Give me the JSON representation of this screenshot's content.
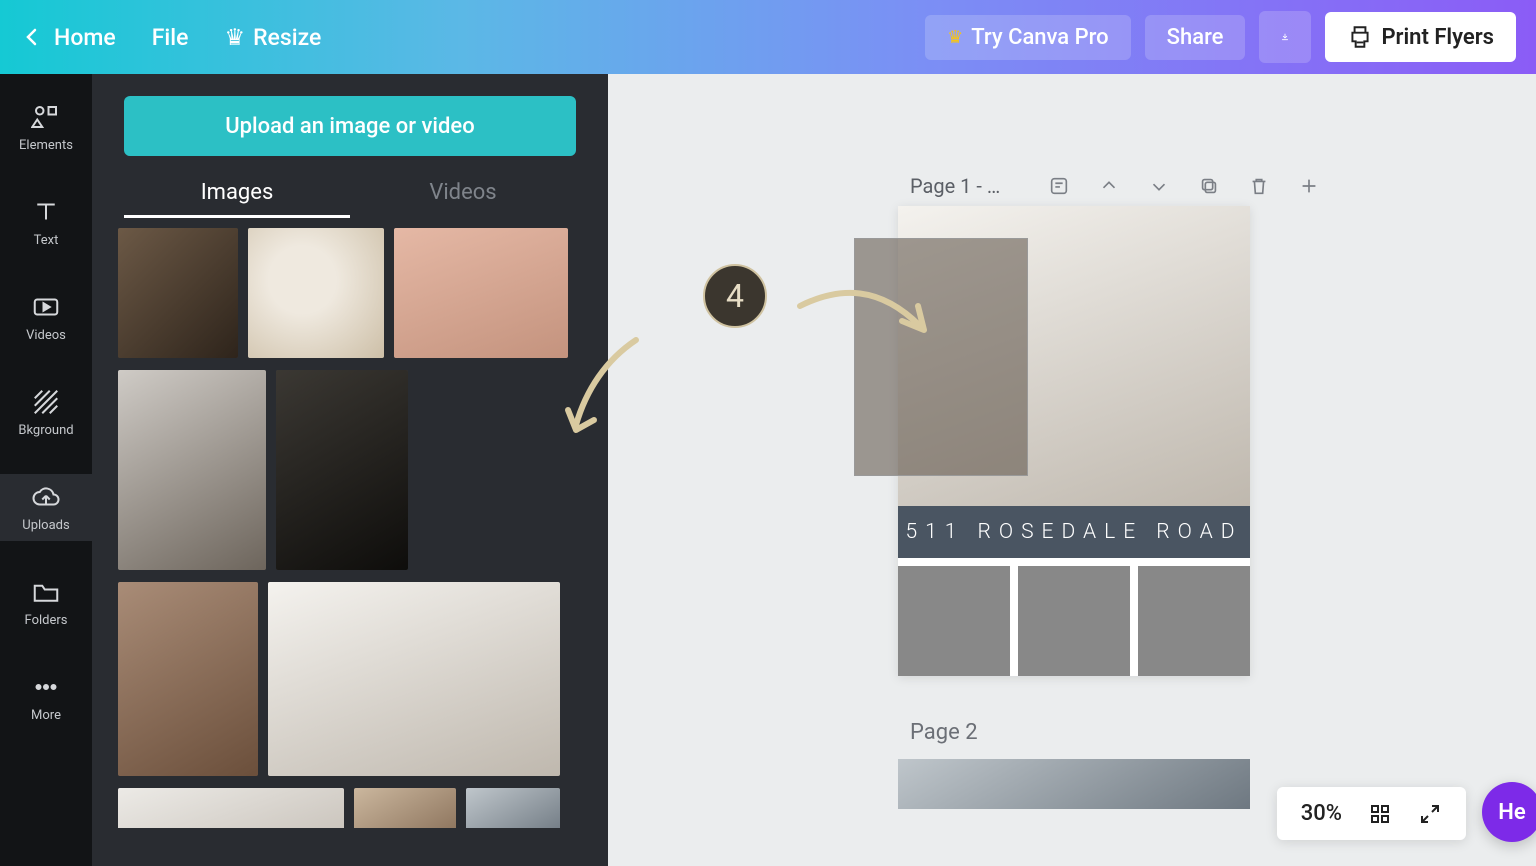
{
  "topbar": {
    "home": "Home",
    "file": "File",
    "resize": "Resize",
    "try_pro": "Try Canva Pro",
    "share": "Share",
    "print": "Print Flyers"
  },
  "rail": {
    "elements": "Elements",
    "text": "Text",
    "videos": "Videos",
    "bkground": "Bkground",
    "uploads": "Uploads",
    "folders": "Folders",
    "more": "More"
  },
  "panel": {
    "upload": "Upload an image or video",
    "tab_images": "Images",
    "tab_videos": "Videos"
  },
  "canvas": {
    "page1_label": "Page 1 - …",
    "flyer_title": "511 ROSEDALE ROAD",
    "page2_label": "Page 2"
  },
  "zoom": {
    "value": "30%"
  },
  "help": "He",
  "step": "4"
}
